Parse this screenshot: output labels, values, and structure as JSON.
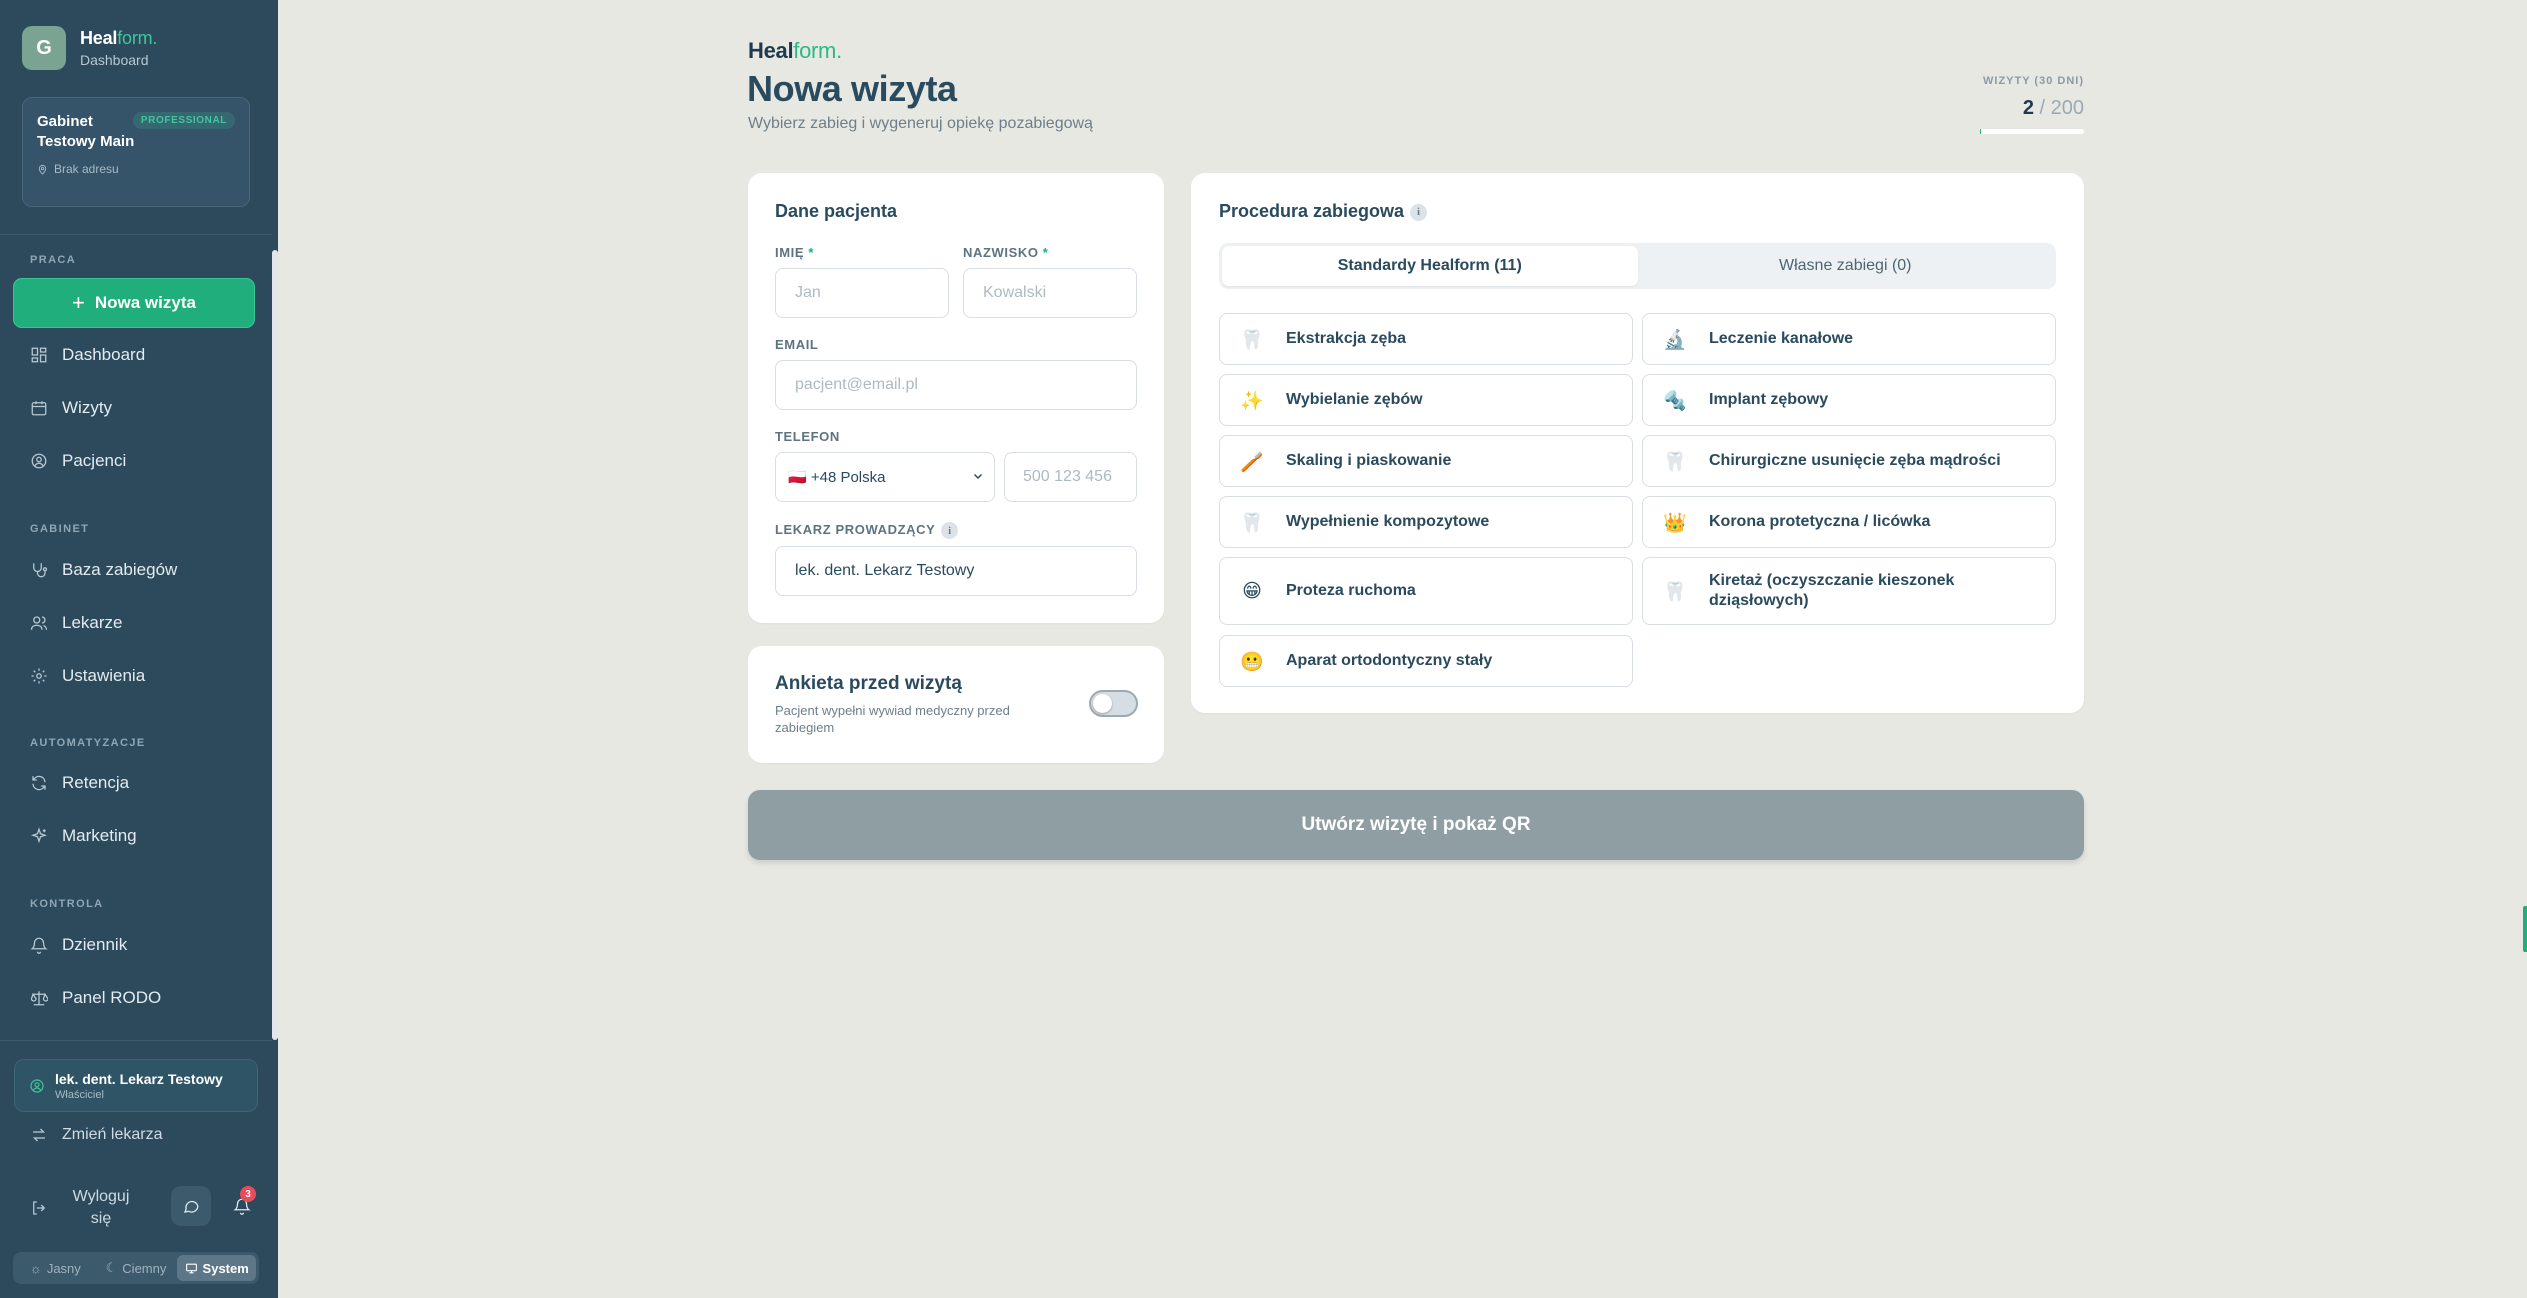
{
  "sidebar": {
    "avatar_letter": "G",
    "brand_left": "Heal",
    "brand_right": "form.",
    "brand_sub": "Dashboard",
    "clinic": {
      "name": "Gabinet Testowy Main",
      "badge": "PROFESSIONAL",
      "address": "Brak adresu"
    },
    "sections": {
      "work": "PRACA",
      "clinic": "GABINET",
      "automation": "AUTOMATYZACJE",
      "control": "KONTROLA"
    },
    "new_visit": "Nowa wizyta",
    "items": {
      "dashboard": "Dashboard",
      "visits": "Wizyty",
      "patients": "Pacjenci",
      "procedures": "Baza zabiegów",
      "doctors": "Lekarze",
      "settings": "Ustawienia",
      "retention": "Retencja",
      "marketing": "Marketing",
      "log": "Dziennik",
      "gdpr": "Panel RODO"
    },
    "doctor": {
      "name": "lek. dent. Lekarz Testowy",
      "role": "Właściciel"
    },
    "switch_doctor": "Zmień lekarza",
    "logout": "Wyloguj się",
    "notifications_count": "3",
    "theme": {
      "light": "Jasny",
      "dark": "Ciemny",
      "system": "System",
      "selected": "System"
    }
  },
  "header": {
    "logo_left": "Heal",
    "logo_right": "form.",
    "title": "Nowa wizyta",
    "subtitle": "Wybierz zabieg i wygeneruj opiekę pozabiegową",
    "counter_label": "WIZYTY (30 DNI)",
    "counter_value": "2",
    "counter_limit": "/ 200",
    "counter_fraction": 0.01
  },
  "patient": {
    "title": "Dane pacjenta",
    "first_name_label": "IMIĘ",
    "first_name_placeholder": "Jan",
    "last_name_label": "NAZWISKO",
    "last_name_placeholder": "Kowalski",
    "required_mark": "*",
    "email_label": "EMAIL",
    "email_placeholder": "pacjent@email.pl",
    "phone_label": "TELEFON",
    "country_value": "🇵🇱 +48 Polska",
    "phone_placeholder": "500 123 456",
    "doctor_label": "LEKARZ PROWADZĄCY",
    "doctor_value": "lek. dent. Lekarz Testowy"
  },
  "survey": {
    "title": "Ankieta przed wizytą",
    "description": "Pacjent wypełni wywiad medyczny przed zabiegiem",
    "enabled": false
  },
  "procedure": {
    "title": "Procedura zabiegowa",
    "tabs": [
      "Standardy Healform (11)",
      "Własne zabiegi (0)"
    ],
    "active_tab": 0,
    "items": [
      {
        "icon": "tooth-icon",
        "glyph": "🦷",
        "label": "Ekstrakcja zęba"
      },
      {
        "icon": "microscope-icon",
        "glyph": "🔬",
        "label": "Leczenie kanałowe"
      },
      {
        "icon": "sparkles-icon",
        "glyph": "✨",
        "label": "Wybielanie zębów"
      },
      {
        "icon": "screw-icon",
        "glyph": "🔩",
        "label": "Implant zębowy"
      },
      {
        "icon": "toothbrush-icon",
        "glyph": "🪥",
        "label": "Skaling i piaskowanie"
      },
      {
        "icon": "tooth-icon",
        "glyph": "🦷",
        "label": "Chirurgiczne usunięcie zęba mądrości"
      },
      {
        "icon": "tooth-icon",
        "glyph": "🦷",
        "label": "Wypełnienie kompozytowe"
      },
      {
        "icon": "crown-icon",
        "glyph": "👑",
        "label": "Korona protetyczna / licówka"
      },
      {
        "icon": "grin-icon",
        "glyph": "😁",
        "label": "Proteza ruchoma"
      },
      {
        "icon": "tooth-icon",
        "glyph": "🦷",
        "label": "Kiretaż (oczyszczanie kieszonek dziąsłowych)"
      },
      {
        "icon": "grimace-icon",
        "glyph": "😬",
        "label": "Aparat ortodontyczny stały"
      }
    ]
  },
  "submit_label": "Utwórz wizytę i pokaż QR"
}
